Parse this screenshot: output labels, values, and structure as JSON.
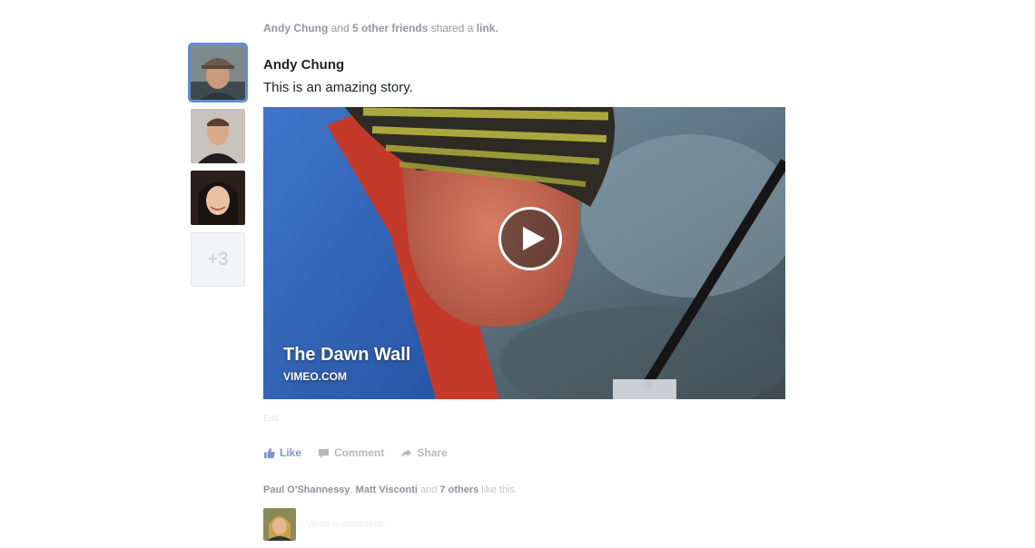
{
  "header": {
    "actor": "Andy Chung",
    "connector": "and",
    "others": "5 other friends",
    "action": "shared a",
    "object": "link."
  },
  "friends": {
    "more_label": "+3"
  },
  "post": {
    "author": "Andy Chung",
    "message": "This is an amazing story."
  },
  "video": {
    "title": "The Dawn Wall",
    "source": "VIMEO.COM"
  },
  "meta": {
    "faded": "Edit"
  },
  "actions": {
    "like": "Like",
    "comment": "Comment",
    "share": "Share"
  },
  "likes": {
    "person1": "Paul O'Shannessy",
    "person2": "Matt Visconti",
    "connector": "and",
    "others": "7 others",
    "suffix": "like this."
  },
  "comment": {
    "placeholder": "Write a comment..."
  },
  "colors": {
    "link_blue": "#7f96c6",
    "selected_outline": "#5b8fd6",
    "muted_text": "#9197a3"
  }
}
